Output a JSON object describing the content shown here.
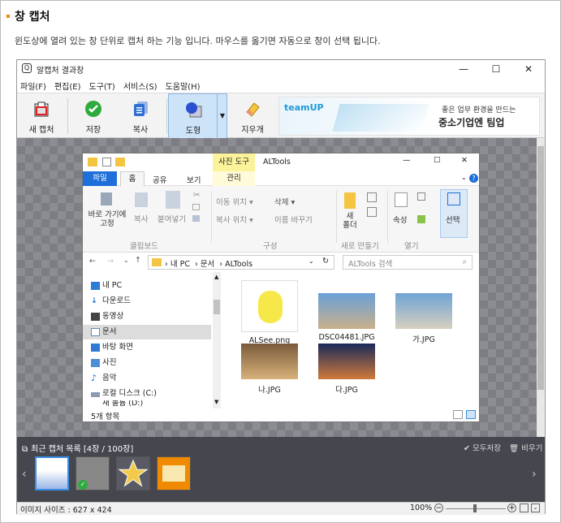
{
  "section": {
    "title": "창 캡처",
    "description": "윈도상에 열려 있는 창 단위로 캡처 하는 기능 입니다. 마우스를 옮기면 자동으로 창이 선택 됩니다."
  },
  "window": {
    "title": "알캡처 결과창",
    "minimize": "—",
    "maximize": "☐",
    "close": "✕"
  },
  "menu": [
    "파일(F)",
    "편집(E)",
    "도구(T)",
    "서비스(S)",
    "도움말(H)"
  ],
  "toolbar": {
    "new_capture": "새 캡처",
    "save": "저장",
    "copy": "복사",
    "shape": "도형",
    "eraser": "지우개"
  },
  "ad": {
    "brand": "teamUP",
    "line1": "좋은 업무 환경을 만드는",
    "line2": "중소기업엔 팀업"
  },
  "explorer": {
    "contextual_tab": "사진 도구",
    "title": "ALTools",
    "tabs": [
      "파일",
      "홈",
      "공유",
      "보기",
      "관리"
    ],
    "ribbon": {
      "pin": "바로 가기에\n고정",
      "copy": "복사",
      "paste": "붙여넣기",
      "move_to": "이동 위치 ▾",
      "copy_to": "복사 위치 ▾",
      "delete": "삭제 ▾",
      "rename": "이름 바꾸기",
      "new_folder": "새\n폴더",
      "open": "속성",
      "select": "선택",
      "groups": [
        "클립보드",
        "구성",
        "새로 만들기",
        "열기"
      ]
    },
    "path": [
      "내 PC",
      "문서",
      "ALTools"
    ],
    "search_placeholder": "ALTools 검색",
    "nav": [
      "내 PC",
      "다운로드",
      "동영상",
      "문서",
      "바탕 화면",
      "사진",
      "음악",
      "로컬 디스크 (C:)",
      "새 볼륨 (D:)"
    ],
    "files": [
      "ALSee.png",
      "DSC04481.JPG",
      "가.JPG",
      "나.JPG",
      "다.JPG"
    ],
    "status": "5개 항목"
  },
  "recent": {
    "title": "최근 캡처 목록 [4장 / 100장]",
    "save_all": "모두저장",
    "clear": "비우기"
  },
  "status": {
    "image_size": "이미지 사이즈 : 627 x 424",
    "zoom": "100%"
  },
  "colors": {
    "accent": "#f08a00",
    "window_blue": "#1e6fd9",
    "selected_border": "#3a8ee6"
  }
}
